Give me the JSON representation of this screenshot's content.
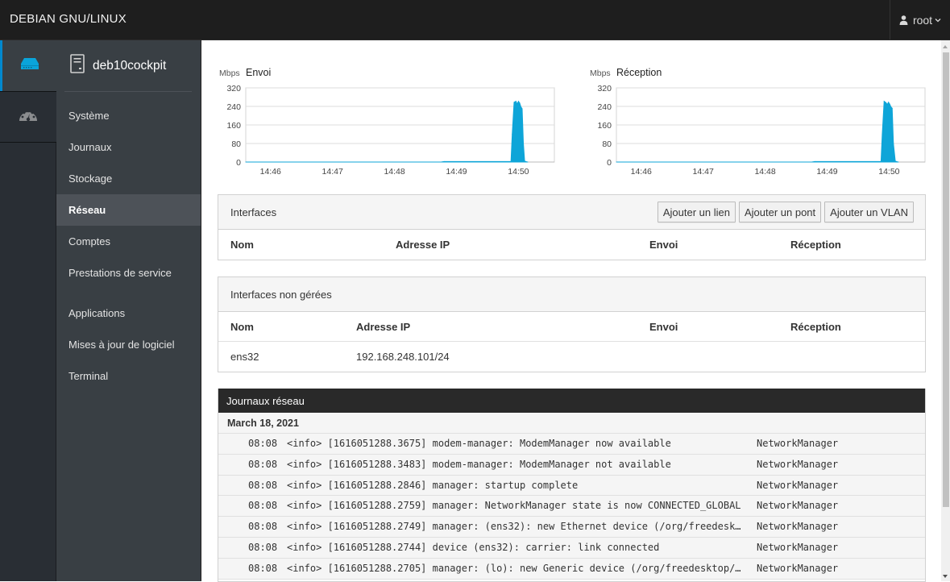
{
  "topbar": {
    "brand": "DEBIAN GNU/LINUX",
    "user": "root",
    "user_icon": "user-icon",
    "caret_icon": "chevron-down-icon"
  },
  "rail": {
    "items": [
      {
        "icon": "server-icon",
        "active": true
      },
      {
        "icon": "dashboard-icon",
        "active": false
      }
    ]
  },
  "nav": {
    "host_icon": "host-icon",
    "host": "deb10cockpit",
    "items": [
      {
        "label": "Système",
        "active": false
      },
      {
        "label": "Journaux",
        "active": false
      },
      {
        "label": "Stockage",
        "active": false
      },
      {
        "label": "Réseau",
        "active": true
      },
      {
        "label": "Comptes",
        "active": false
      },
      {
        "label": "Prestations de service",
        "active": false
      },
      {
        "label": "Applications",
        "active": false
      },
      {
        "label": "Mises à jour de logiciel",
        "active": false
      },
      {
        "label": "Terminal",
        "active": false
      }
    ]
  },
  "colors": {
    "accent": "#0088ce",
    "chart_fill": "#0ea5d8",
    "topbar": "#1e1e1e",
    "nav_bg": "#393f44"
  },
  "chart_data": [
    {
      "type": "area",
      "title": "Envoi",
      "ylabel": "Mbps",
      "xlabel": "",
      "ylim": [
        0,
        320
      ],
      "yticks": [
        0,
        80,
        160,
        240,
        320
      ],
      "xticks": [
        "14:46",
        "14:47",
        "14:48",
        "14:49",
        "14:50"
      ],
      "grid": true,
      "x_minutes": [
        0,
        3.15,
        3.2,
        4.28,
        4.3,
        4.33,
        4.36,
        4.38,
        4.4,
        4.42,
        4.44,
        4.46,
        4.48,
        4.5,
        4.52,
        4.55
      ],
      "values": [
        0,
        0,
        2,
        2,
        120,
        258,
        262,
        250,
        262,
        255,
        238,
        230,
        80,
        4,
        2,
        0
      ],
      "x_origin": "14:45.6"
    },
    {
      "type": "area",
      "title": "Réception",
      "ylabel": "Mbps",
      "xlabel": "",
      "ylim": [
        0,
        320
      ],
      "yticks": [
        0,
        80,
        160,
        240,
        320
      ],
      "xticks": [
        "14:46",
        "14:47",
        "14:48",
        "14:49",
        "14:50"
      ],
      "grid": true,
      "x_minutes": [
        0,
        3.15,
        3.2,
        4.27,
        4.29,
        4.32,
        4.35,
        4.37,
        4.39,
        4.41,
        4.43,
        4.45,
        4.47,
        4.5,
        4.52,
        4.55
      ],
      "values": [
        0,
        0,
        2,
        2,
        120,
        262,
        256,
        248,
        258,
        250,
        238,
        232,
        80,
        4,
        2,
        0
      ],
      "x_origin": "14:45.6"
    }
  ],
  "interfaces": {
    "title": "Interfaces",
    "buttons": [
      "Ajouter un lien",
      "Ajouter un pont",
      "Ajouter un VLAN"
    ],
    "columns": [
      "Nom",
      "Adresse IP",
      "Envoi",
      "Réception"
    ],
    "rows": []
  },
  "unmanaged": {
    "title": "Interfaces non gérées",
    "columns": [
      "Nom",
      "Adresse IP",
      "Envoi",
      "Réception"
    ],
    "rows": [
      {
        "name": "ens32",
        "ip": "192.168.248.101/24",
        "send": "",
        "recv": ""
      }
    ]
  },
  "logs": {
    "title": "Journaux réseau",
    "date": "March 18, 2021",
    "entries": [
      {
        "time": "08:08",
        "message": "<info> [1616051288.3675] modem-manager: ModemManager now available",
        "source": "NetworkManager"
      },
      {
        "time": "08:08",
        "message": "<info> [1616051288.3483] modem-manager: ModemManager not available",
        "source": "NetworkManager"
      },
      {
        "time": "08:08",
        "message": "<info> [1616051288.2846] manager: startup complete",
        "source": "NetworkManager"
      },
      {
        "time": "08:08",
        "message": "<info> [1616051288.2759] manager: NetworkManager state is now CONNECTED_GLOBAL",
        "source": "NetworkManager"
      },
      {
        "time": "08:08",
        "message": "<info> [1616051288.2749] manager: (ens32): new Ethernet device (/org/freedesk…",
        "source": "NetworkManager"
      },
      {
        "time": "08:08",
        "message": "<info> [1616051288.2744] device (ens32): carrier: link connected",
        "source": "NetworkManager"
      },
      {
        "time": "08:08",
        "message": "<info> [1616051288.2705] manager: (lo): new Generic device (/org/freedesktop/…",
        "source": "NetworkManager"
      }
    ]
  }
}
